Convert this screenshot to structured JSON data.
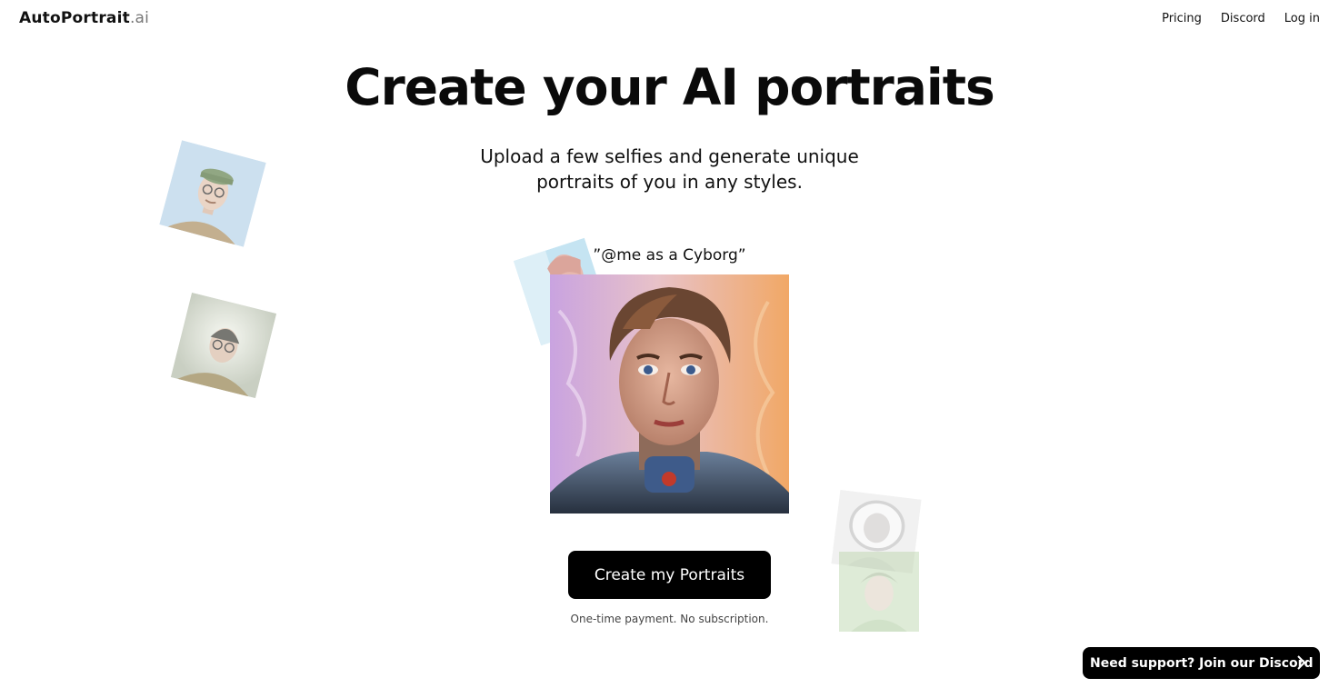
{
  "brand": {
    "name": "AutoPortrait",
    "tld": ".ai"
  },
  "nav": {
    "items": [
      "Pricing",
      "Discord",
      "Log in"
    ]
  },
  "hero": {
    "title": "Create your AI portraits",
    "subtitle": "Upload a few selfies and generate unique portraits of you in any styles.",
    "prompt": "”@me as a Cyborg”"
  },
  "cta": {
    "label": "Create my Portraits",
    "note": "One-time payment. No subscription."
  },
  "support": {
    "label": "Need support? Join our Discord",
    "icon": "chevron-right-icon"
  },
  "colors": {
    "button_bg": "#000000",
    "button_text": "#ffffff"
  }
}
